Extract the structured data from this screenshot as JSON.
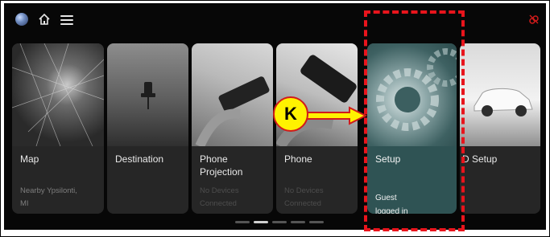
{
  "header": {
    "icons": [
      "globe-icon",
      "home-icon",
      "menu-icon",
      "connectivity-off-icon"
    ],
    "accent_color": "#d11b1b"
  },
  "cards": [
    {
      "id": "map",
      "title": "Map",
      "subtitle_line1": "Nearby Ypsilonti,",
      "subtitle_line2": "MI",
      "image": "city-night-aerial"
    },
    {
      "id": "destination",
      "title": "Destination",
      "image": "map-pin"
    },
    {
      "id": "phone-projection",
      "title_line1": "Phone",
      "title_line2": "Projection",
      "subtitle_line1": "No Devices",
      "subtitle_line2": "Connected",
      "image": "hand-holding-phone"
    },
    {
      "id": "phone",
      "title": "Phone",
      "subtitle_line1": "No Devices",
      "subtitle_line2": "Connected",
      "image": "phone-in-hand"
    },
    {
      "id": "setup",
      "title": "Setup",
      "subtitle_line1": "Guest",
      "subtitle_line2": "logged in",
      "image": "gears",
      "highlighted": true
    },
    {
      "id": "d-setup",
      "title": "D Setup",
      "image": "white-suv"
    }
  ],
  "pager": {
    "pages": 5,
    "active_index": 1
  },
  "annotation": {
    "marker_label": "K",
    "color": "#e8141c",
    "marker_fill": "#fff200"
  }
}
